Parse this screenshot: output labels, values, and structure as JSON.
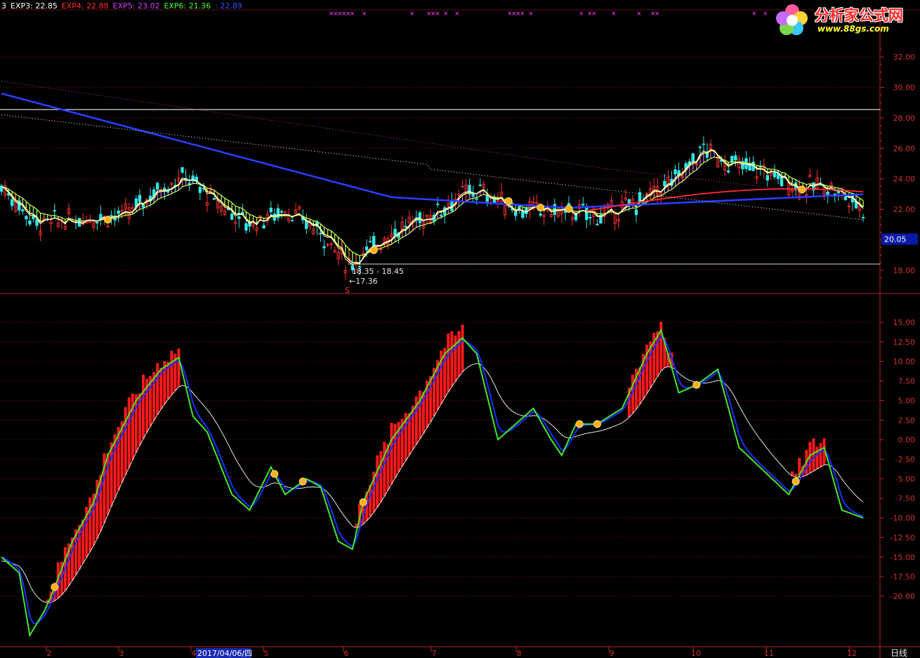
{
  "header": {
    "prefix": "3",
    "exp3": "EXP3: 22.85",
    "exp4": "EXP4: 22.88",
    "exp5": "EXP5: 23.02",
    "exp6": "EXP6: 21.36",
    "last": ": 22.89"
  },
  "colors": {
    "exp3": "#ffffff",
    "exp4": "#ff3030",
    "exp5": "#d040ff",
    "exp6": "#40ff40",
    "last": "#3050ff",
    "grid": "#7a1010",
    "axis": "#c02020"
  },
  "logo": {
    "title": "分析家公式网",
    "url": "www.88gs.com"
  },
  "price_axis": {
    "ticks": [
      "32.00",
      "30.00",
      "28.00",
      "26.00",
      "24.00",
      "22.00",
      "20.00",
      "18.00"
    ],
    "current_price": "20.05"
  },
  "indicator_axis": {
    "ticks": [
      "15.00",
      "12.50",
      "10.00",
      "7.50",
      "5.00",
      "2.50",
      "0.00",
      "-2.50",
      "-5.00",
      "-7.50",
      "-10.00",
      "-12.50",
      "-15.00",
      "-17.50",
      "-20.00"
    ]
  },
  "annotations": {
    "range_label": "18.35 - 18.45",
    "low_label": "←17.36",
    "sell_marker": "S"
  },
  "time_axis": {
    "labels": [
      "2",
      "3",
      "4",
      "2017/04/06/四",
      "5",
      "6",
      "7",
      "8",
      "9",
      "10",
      "11",
      "12"
    ],
    "period": "日线"
  },
  "chart_data": {
    "type": "candlestick+indicator",
    "price_ylim": [
      17,
      33
    ],
    "indicator_ylim": [
      -25,
      17
    ],
    "exp_lines": {
      "EXP3": 22.85,
      "EXP4": 22.88,
      "EXP5": 23.02,
      "EXP6": 21.36,
      "last": 22.89
    },
    "horizontal_lines": [
      28.5,
      18.4
    ]
  }
}
